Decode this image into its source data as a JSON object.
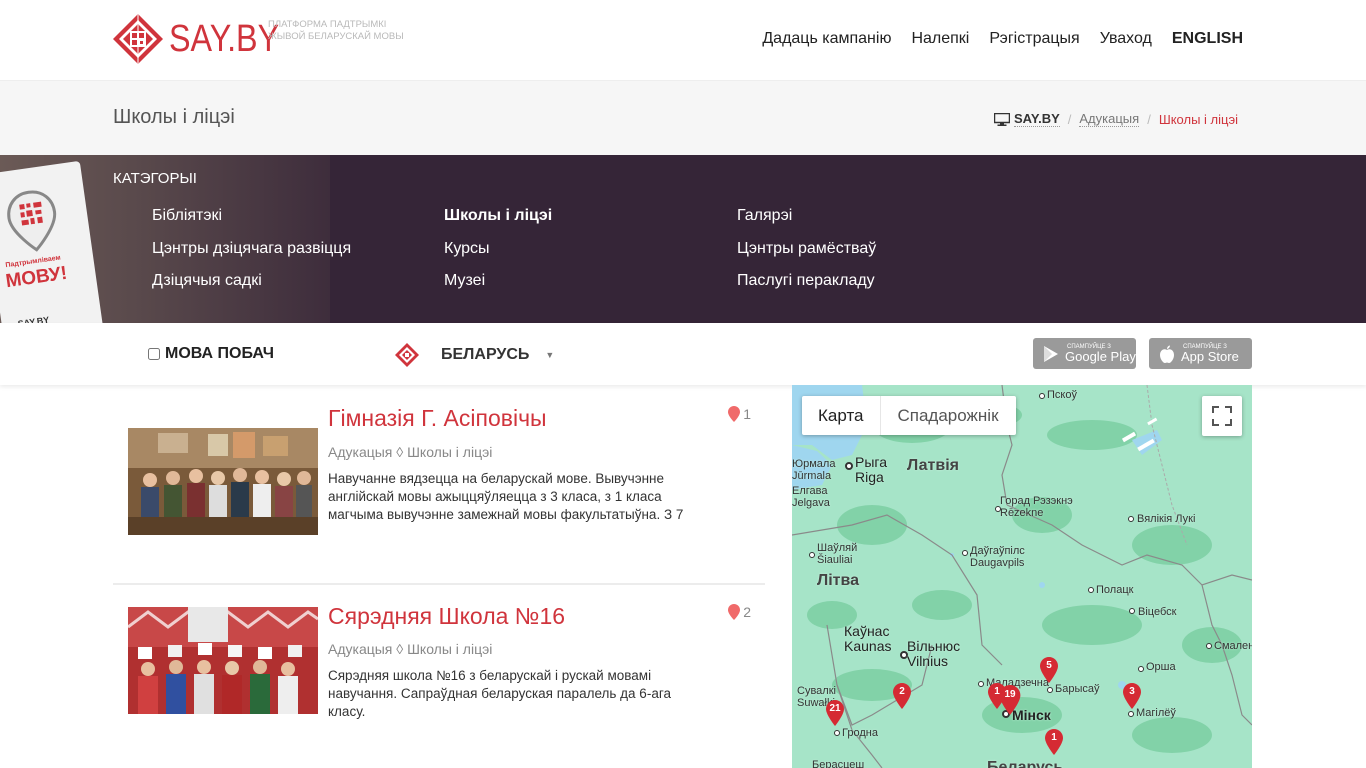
{
  "header": {
    "logo_text": "SAY.BY",
    "tagline": "Платформа падтрымкі жывой беларускай мовы",
    "nav": [
      {
        "label": "Дадаць кампанію"
      },
      {
        "label": "Налепкі"
      },
      {
        "label": "Рэгістрацыя"
      },
      {
        "label": "Уваход"
      },
      {
        "label": "ENGLISH"
      }
    ]
  },
  "titlebar": {
    "title": "Школы і ліцэі",
    "breadcrumb": [
      "SAY.BY",
      "Адукацыя",
      "Школы і ліцэі"
    ]
  },
  "categories": {
    "heading": "Катэгорыі",
    "sticker_small": "Падтрымліваем",
    "sticker_big": "МОВУ!",
    "sticker_brand": "SAY.BY",
    "col1": [
      "Бібліятэкі",
      "Цэнтры дзіцячага развіцця",
      "Дзіцячыя садкі"
    ],
    "col2": [
      "Школы і ліцэі",
      "Курсы",
      "Музеі"
    ],
    "col3": [
      "Галярэі",
      "Цэнтры рамёстваў",
      "Паслугі перакладу"
    ],
    "active": "Школы і ліцэі"
  },
  "filter": {
    "mova_label": "МОВА ПОБАЧ",
    "country": "БЕЛАРУСЬ",
    "google_small": "СПАМПУЙЦЕ З",
    "google_big": "Google Play",
    "apple_small": "СПАМПУЙЦЕ З",
    "apple_big": "App Store"
  },
  "listings": [
    {
      "title": "Гімназія Г. Асіповічы",
      "meta": "Адукацыя ◊ Школы і ліцэі",
      "desc": "Навучанне вядзецца на беларускай мове. Вывучэнне англійскай мовы ажыццяўляецца з 3 класа, з 1 класа магчыма вывучэнне замежнай мовы факультатыўна. З 7",
      "count": "1"
    },
    {
      "title": "Сярэдняя Школа №16",
      "meta": "Адукацыя ◊ Школы і ліцэі",
      "desc": "Сярэдняя школа №16 з беларускай і рускай мовамі навучання. Сапраўдная беларуская паралель да 6-ага класу.",
      "count": "2"
    }
  ],
  "map": {
    "tab_map": "Карта",
    "tab_sat": "Спадарожнік",
    "labels": {
      "pskov": "Пскоў",
      "jurmala1": "Юрмала",
      "jurmala2": "Jūrmala",
      "riga1": "Рыга",
      "riga2": "Riga",
      "latvia": "Латвія",
      "jelgava1": "Елгава",
      "jelgava2": "Jelgava",
      "rezekne1": "Горад Рэзэкнэ",
      "rezekne2": "Rēzekne",
      "velikie": "Вялікія Лукі",
      "siauliai1": "Шаўляй",
      "siauliai2": "Šiauliai",
      "daugavpils1": "Даўгаўпілс",
      "daugavpils2": "Daugavpils",
      "lithuania": "Літва",
      "polatsk": "Полацк",
      "vitsebsk": "Віцебск",
      "kaunas1": "Каўнас",
      "kaunas2": "Kaunas",
      "vilnius1": "Вільнюс",
      "vilnius2": "Vilnius",
      "smalensk": "Смален",
      "orsha": "Орша",
      "maladechna": "Маладзечна",
      "barysau": "Барысаў",
      "suwalki1": "Сувалкі",
      "suwalki2": "Suwałki",
      "minsk": "Мінск",
      "mahilou": "Магілёў",
      "hrodna": "Гродна",
      "brest": "Берасцеш",
      "belarus": "Беларусь"
    },
    "pins": [
      "5",
      "1",
      "19",
      "3",
      "2",
      "21",
      "1"
    ]
  }
}
